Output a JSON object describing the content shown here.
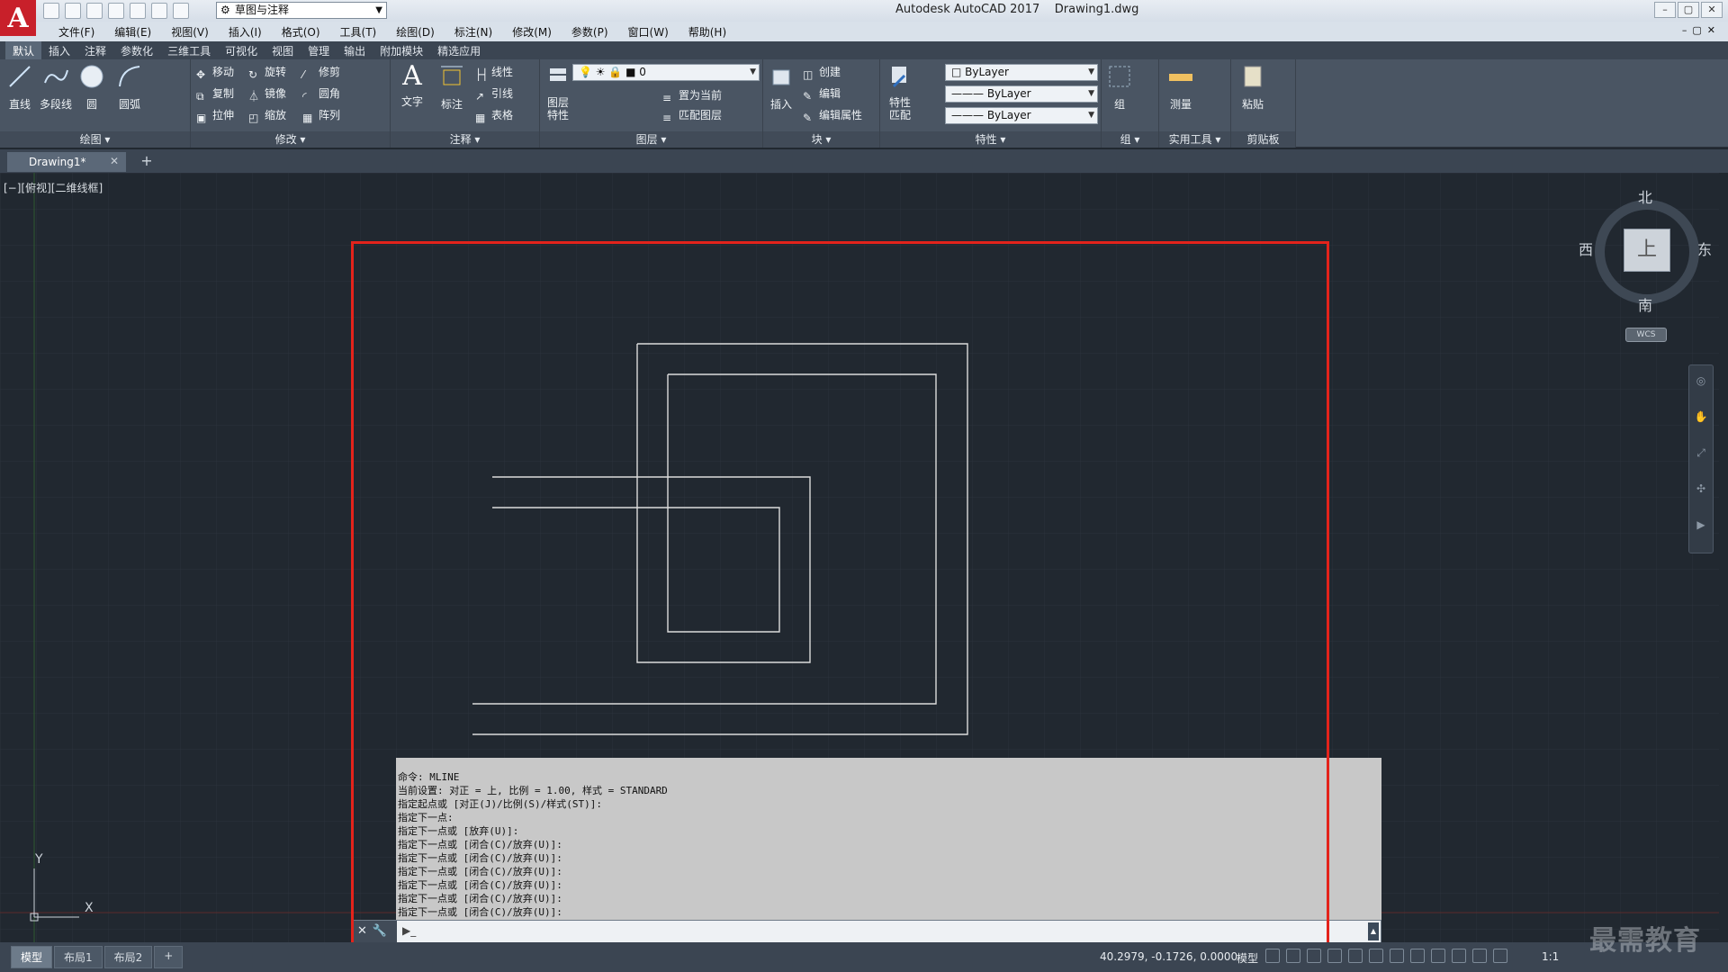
{
  "app": {
    "title": "Autodesk AutoCAD 2017    Drawing1.dwg",
    "logo": "A",
    "workspace": "草图与注释"
  },
  "menu": [
    "文件(F)",
    "编辑(E)",
    "视图(V)",
    "插入(I)",
    "格式(O)",
    "工具(T)",
    "绘图(D)",
    "标注(N)",
    "修改(M)",
    "参数(P)",
    "窗口(W)",
    "帮助(H)"
  ],
  "ribbon_tabs": [
    "默认",
    "插入",
    "注释",
    "参数化",
    "三维工具",
    "可视化",
    "视图",
    "管理",
    "输出",
    "附加模块",
    "精选应用"
  ],
  "panels": {
    "draw": {
      "title": "绘图",
      "line": "直线",
      "polyline": "多段线",
      "circle": "圆",
      "arc": "圆弧"
    },
    "modify": {
      "title": "修改",
      "move": "移动",
      "rotate": "旋转",
      "trim": "修剪",
      "copy": "复制",
      "mirror": "镜像",
      "fillet": "圆角",
      "stretch": "拉伸",
      "scale": "缩放",
      "array": "阵列"
    },
    "annotation": {
      "title": "注释",
      "text": "文字",
      "dimension": "标注",
      "linear": "线性",
      "leader": "引线",
      "table": "表格"
    },
    "layers": {
      "title": "图层",
      "properties": "图层\n特性",
      "current_layer": "0",
      "set_current": "置为当前",
      "match_layer": "匹配图层"
    },
    "block": {
      "title": "块",
      "insert": "插入",
      "create": "创建",
      "edit": "编辑",
      "edit_attr": "编辑属性"
    },
    "properties": {
      "title": "特性",
      "match": "特性\n匹配",
      "color": "ByLayer",
      "linetype": "ByLayer",
      "lineweight": "ByLayer"
    },
    "groups": {
      "title": "组",
      "group": "组"
    },
    "utilities": {
      "title": "实用工具",
      "measure": "测量"
    },
    "clipboard": {
      "title": "剪贴板",
      "paste": "粘贴"
    }
  },
  "file_tab": "Drawing1*",
  "viewport": {
    "label": "[−][俯视][二维线框]",
    "viewcube": {
      "top": "上",
      "north": "北",
      "south": "南",
      "east": "东",
      "west": "西",
      "wcs": "WCS"
    },
    "ucs": {
      "x": "X",
      "y": "Y"
    }
  },
  "command": {
    "history": [
      "命令: MLINE",
      "当前设置: 对正 = 上, 比例 = 1.00, 样式 = STANDARD",
      "指定起点或 [对正(J)/比例(S)/样式(ST)]:",
      "指定下一点:",
      "指定下一点或 [放弃(U)]:",
      "指定下一点或 [闭合(C)/放弃(U)]:",
      "指定下一点或 [闭合(C)/放弃(U)]:",
      "指定下一点或 [闭合(C)/放弃(U)]:",
      "指定下一点或 [闭合(C)/放弃(U)]:",
      "指定下一点或 [闭合(C)/放弃(U)]:",
      "指定下一点或 [闭合(C)/放弃(U)]:"
    ],
    "prompt_icon": "▶_"
  },
  "status": {
    "layouts": [
      "模型",
      "布局1",
      "布局2"
    ],
    "coords": "40.2979, -0.1726, 0.0000",
    "model": "模型",
    "scale": "1:1"
  },
  "watermark": "最需教育",
  "colors": {
    "accent_red": "#e3231b",
    "canvas": "#212830",
    "ribbon": "#4a5563",
    "line": "#d8d8d8"
  }
}
